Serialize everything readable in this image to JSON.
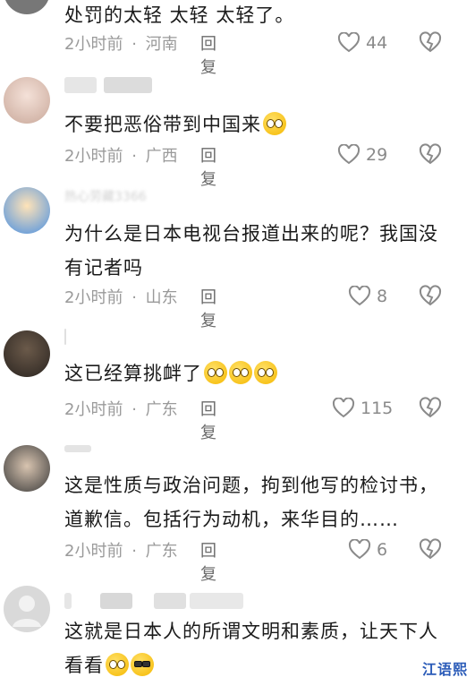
{
  "comments": [
    {
      "text": "处罚的太轻 太轻 太轻了。",
      "time": "2小时前",
      "location": "河南",
      "reply": "回复",
      "likes": "44"
    },
    {
      "text": "不要把恶俗带到中国来",
      "emoji": [
        "shush-emoji"
      ],
      "time": "2小时前",
      "location": "广西",
      "reply": "回复",
      "likes": "29"
    },
    {
      "username": "热心劳藏3366",
      "text": "为什么是日本电视台报道出来的呢？我国没有记者吗",
      "time": "2小时前",
      "location": "山东",
      "reply": "回复",
      "likes": "8"
    },
    {
      "text": "这已经算挑衅了",
      "emoji": [
        "shocked-emoji",
        "shocked-emoji",
        "shocked-emoji"
      ],
      "time": "2小时前",
      "location": "广东",
      "reply": "回复",
      "likes": "115"
    },
    {
      "text": "这是性质与政治问题，拘到他写的检讨书，道歉信。包括行为动机，来华目的……",
      "time": "2小时前",
      "location": "广东",
      "reply": "回复",
      "likes": "6"
    },
    {
      "text": "这就是日本人的所谓文明和素质，让天下人看看",
      "emoji": [
        "shocked-emoji",
        "cool-emoji"
      ],
      "time": "",
      "location": "",
      "reply": "",
      "likes": ""
    }
  ],
  "separator": "·",
  "watermark": "江语熙",
  "colors": {
    "meta": "#9a9a9a",
    "reply": "#6a6a6a",
    "text": "#1b1b1b"
  }
}
